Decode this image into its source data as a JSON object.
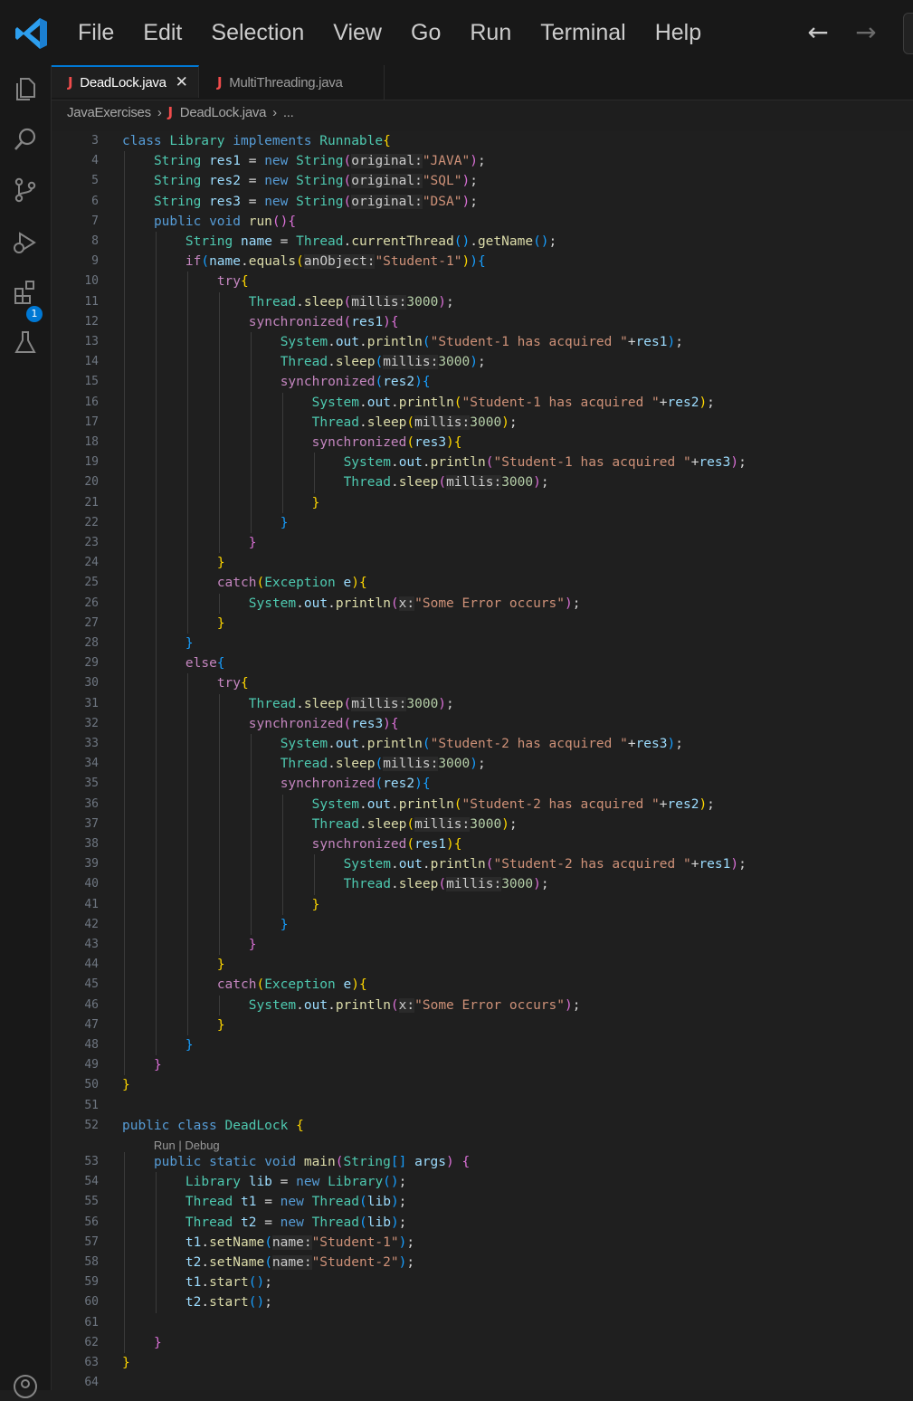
{
  "menu": [
    "File",
    "Edit",
    "Selection",
    "View",
    "Go",
    "Run",
    "Terminal",
    "Help"
  ],
  "tabs": [
    {
      "label": "DeadLock.java",
      "active": true
    },
    {
      "label": "MultiThreading.java",
      "active": false
    }
  ],
  "breadcrumb": {
    "folder": "JavaExercises",
    "file": "DeadLock.java",
    "more": "..."
  },
  "activity_badge": "1",
  "icons": {
    "explorer": "files-icon",
    "search": "search-icon",
    "scm": "source-control-icon",
    "debug": "run-debug-icon",
    "extensions": "extensions-icon",
    "testing": "flask-icon",
    "account": "account-icon"
  },
  "colors": {
    "accent": "#0078d4",
    "java_icon": "#f14c4c",
    "editor_bg": "#1f1f1f"
  },
  "codelens": {
    "before_line": 53,
    "text": "Run | Debug"
  },
  "line_numbers": [
    3,
    4,
    5,
    6,
    7,
    8,
    9,
    10,
    11,
    12,
    13,
    14,
    15,
    16,
    17,
    18,
    19,
    20,
    21,
    22,
    23,
    24,
    25,
    26,
    27,
    28,
    29,
    30,
    31,
    32,
    33,
    34,
    35,
    36,
    37,
    38,
    39,
    40,
    41,
    42,
    43,
    44,
    45,
    46,
    47,
    48,
    49,
    50,
    51,
    52,
    53,
    54,
    55,
    56,
    57,
    58,
    59,
    60,
    61,
    62,
    63,
    64
  ],
  "code_lines": [
    "class Library implements Runnable{",
    "    String res1 = new String(original:\"JAVA\");",
    "    String res2 = new String(original:\"SQL\");",
    "    String res3 = new String(original:\"DSA\");",
    "    public void run(){",
    "        String name = Thread.currentThread().getName();",
    "        if(name.equals(anObject:\"Student-1\")){",
    "            try{",
    "                Thread.sleep(millis:3000);",
    "                synchronized(res1){",
    "                    System.out.println(\"Student-1 has acquired \"+res1);",
    "                    Thread.sleep(millis:3000);",
    "                    synchronized(res2){",
    "                        System.out.println(\"Student-1 has acquired \"+res2);",
    "                        Thread.sleep(millis:3000);",
    "                        synchronized(res3){",
    "                            System.out.println(\"Student-1 has acquired \"+res3);",
    "                            Thread.sleep(millis:3000);",
    "                        }",
    "                    }",
    "                }",
    "            }",
    "            catch(Exception e){",
    "                System.out.println(x:\"Some Error occurs\");",
    "            }",
    "        }",
    "        else{",
    "            try{",
    "                Thread.sleep(millis:3000);",
    "                synchronized(res3){",
    "                    System.out.println(\"Student-2 has acquired \"+res3);",
    "                    Thread.sleep(millis:3000);",
    "                    synchronized(res2){",
    "                        System.out.println(\"Student-2 has acquired \"+res2);",
    "                        Thread.sleep(millis:3000);",
    "                        synchronized(res1){",
    "                            System.out.println(\"Student-2 has acquired \"+res1);",
    "                            Thread.sleep(millis:3000);",
    "                        }",
    "                    }",
    "                }",
    "            }",
    "            catch(Exception e){",
    "                System.out.println(x:\"Some Error occurs\");",
    "            }",
    "        }",
    "    }",
    "}",
    "",
    "public class DeadLock {",
    "    public static void main(String[] args) {",
    "        Library lib = new Library();",
    "        Thread t1 = new Thread(lib);",
    "        Thread t2 = new Thread(lib);",
    "        t1.setName(name:\"Student-1\");",
    "        t2.setName(name:\"Student-2\");",
    "        t1.start();",
    "        t2.start();",
    "",
    "    }",
    "}",
    ""
  ]
}
